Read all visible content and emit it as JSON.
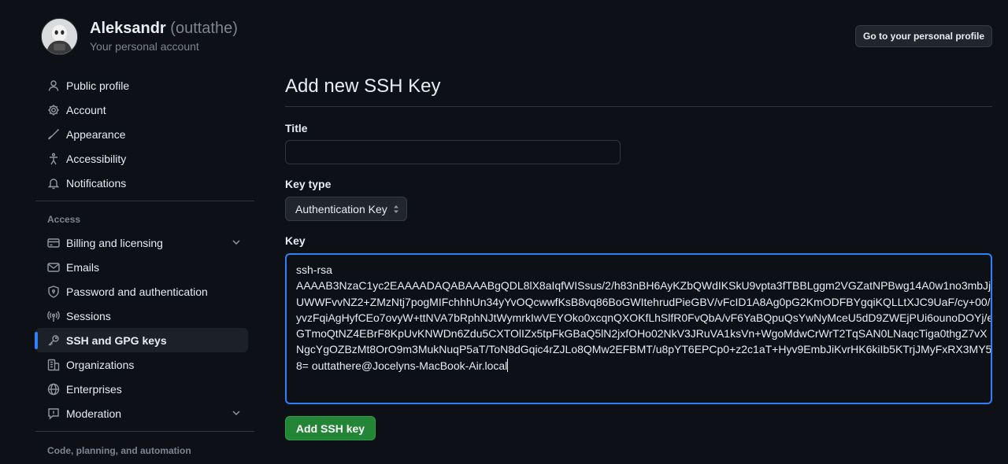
{
  "account": {
    "name": "Aleksandr",
    "handle": "(outtathe)",
    "subtitle": "Your personal account",
    "profile_button": "Go to your personal profile"
  },
  "sidebar": {
    "items": [
      {
        "label": "Public profile",
        "icon": "person-icon"
      },
      {
        "label": "Account",
        "icon": "gear-icon"
      },
      {
        "label": "Appearance",
        "icon": "paintbrush-icon"
      },
      {
        "label": "Accessibility",
        "icon": "accessibility-icon"
      },
      {
        "label": "Notifications",
        "icon": "bell-icon"
      }
    ],
    "access_heading": "Access",
    "access_items": [
      {
        "label": "Billing and licensing",
        "icon": "credit-card-icon",
        "expandable": true
      },
      {
        "label": "Emails",
        "icon": "mail-icon"
      },
      {
        "label": "Password and authentication",
        "icon": "shield-lock-icon"
      },
      {
        "label": "Sessions",
        "icon": "broadcast-icon"
      },
      {
        "label": "SSH and GPG keys",
        "icon": "key-icon",
        "active": true
      },
      {
        "label": "Organizations",
        "icon": "organization-icon"
      },
      {
        "label": "Enterprises",
        "icon": "globe-icon"
      },
      {
        "label": "Moderation",
        "icon": "report-icon",
        "expandable": true
      }
    ],
    "code_heading": "Code, planning, and automation"
  },
  "form": {
    "title": "Add new SSH Key",
    "title_label": "Title",
    "title_value": "",
    "key_type_label": "Key type",
    "key_type_value": "Authentication Key",
    "key_label": "Key",
    "key_lines": [
      "ssh-rsa",
      "AAAAB3NzaC1yc2EAAAADAQABAAABgQDL8lX8aIqfWISsus/2/h83nBH6AyKZbQWdIKSkU9vpta3fTBBLggm2VGZatNPBwg14A0w1no3mbJj",
      "UWWFvvNZ2+ZMzNtj7pogMIFchhhUn34yYvOQcwwfKsB8vq86BoGWItehrudPieGBV/vFcID1A8Ag0pG2KmODFBYgqiKQLLtXJC9UaF/cy+00/",
      "yvzFqiAgHyfCEo7ovyW+ttNVA7bRphNJtWymrkIwVEYOko0xcqnQXOKfLhSlfR0FvQbA/vF6YaBQpuQsYwNyMceU5dD9ZWEjPUi6ounoDOYj/e",
      "GTmoQtNZ4EBrF8KpUvKNWDn6Zdu5CXTOlIZx5tpFkGBaQ5lN2jxfOHo02NkV3JRuVA1ksVn+WgoMdwCrWrT2TqSAN0LNaqcTiga0thgZ7vX",
      "NgcYgOZBzMt8OrO9m3MukNuqP5aT/ToN8dGqic4rZJLo8QMw2EFBMT/u8pYT6EPCp0+z2c1aT+Hyv9EmbJiKvrHK6kiIb5KTrjJMyFxRX3MY5",
      "8= outtathere@Jocelyns-MacBook-Air.local"
    ],
    "submit_label": "Add SSH key"
  },
  "colors": {
    "background": "#0d1117",
    "accent": "#2f81f7",
    "primary_button": "#238636",
    "muted_text": "#7d8590"
  }
}
